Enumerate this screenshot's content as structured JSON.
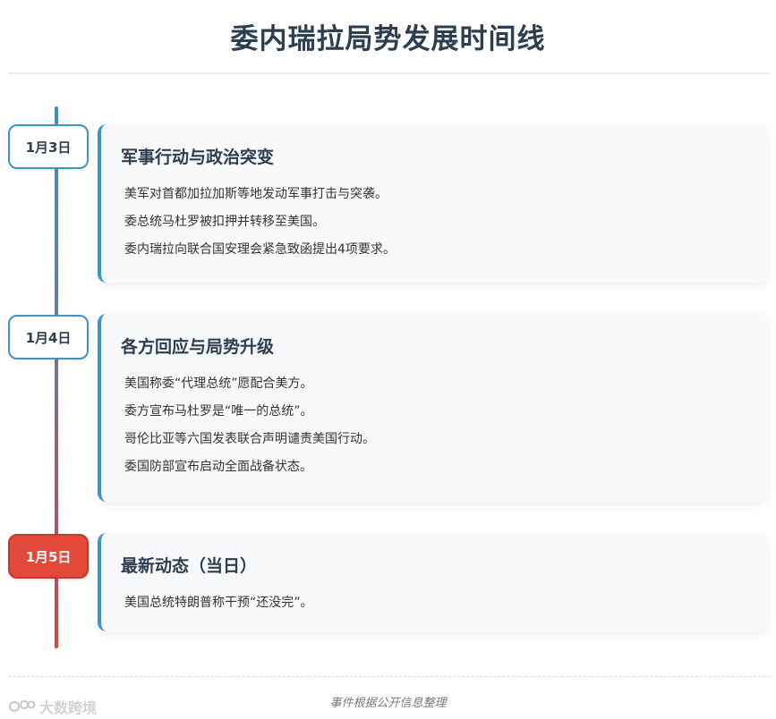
{
  "title": "委内瑞拉局势发展时间线",
  "events": [
    {
      "date": "1月3日",
      "heading": "军事行动与政治突变",
      "items": [
        "美军对首都加拉加斯等地发动军事打击与突袭。",
        "委总统马杜罗被扣押并转移至美国。",
        "委内瑞拉向联合国安理会紧急致函提出4项要求。"
      ]
    },
    {
      "date": "1月4日",
      "heading": "各方回应与局势升级",
      "items": [
        "美国称委“代理总统”愿配合美方。",
        "委方宣布马杜罗是“唯一的总统”。",
        "哥伦比亚等六国发表联合声明谴责美国行动。",
        "委国防部宣布启动全面战备状态。"
      ]
    },
    {
      "date": "1月5日",
      "heading": "最新动态（当日）",
      "items": [
        "美国总统特朗普称干预“还没完”。"
      ],
      "highlight": true
    }
  ],
  "footer": "事件根据公开信息整理",
  "watermark": "大数跨境",
  "colors": {
    "accent_blue": "#3a94cd",
    "accent_red": "#e2493b",
    "title_text": "#2c3e50"
  }
}
